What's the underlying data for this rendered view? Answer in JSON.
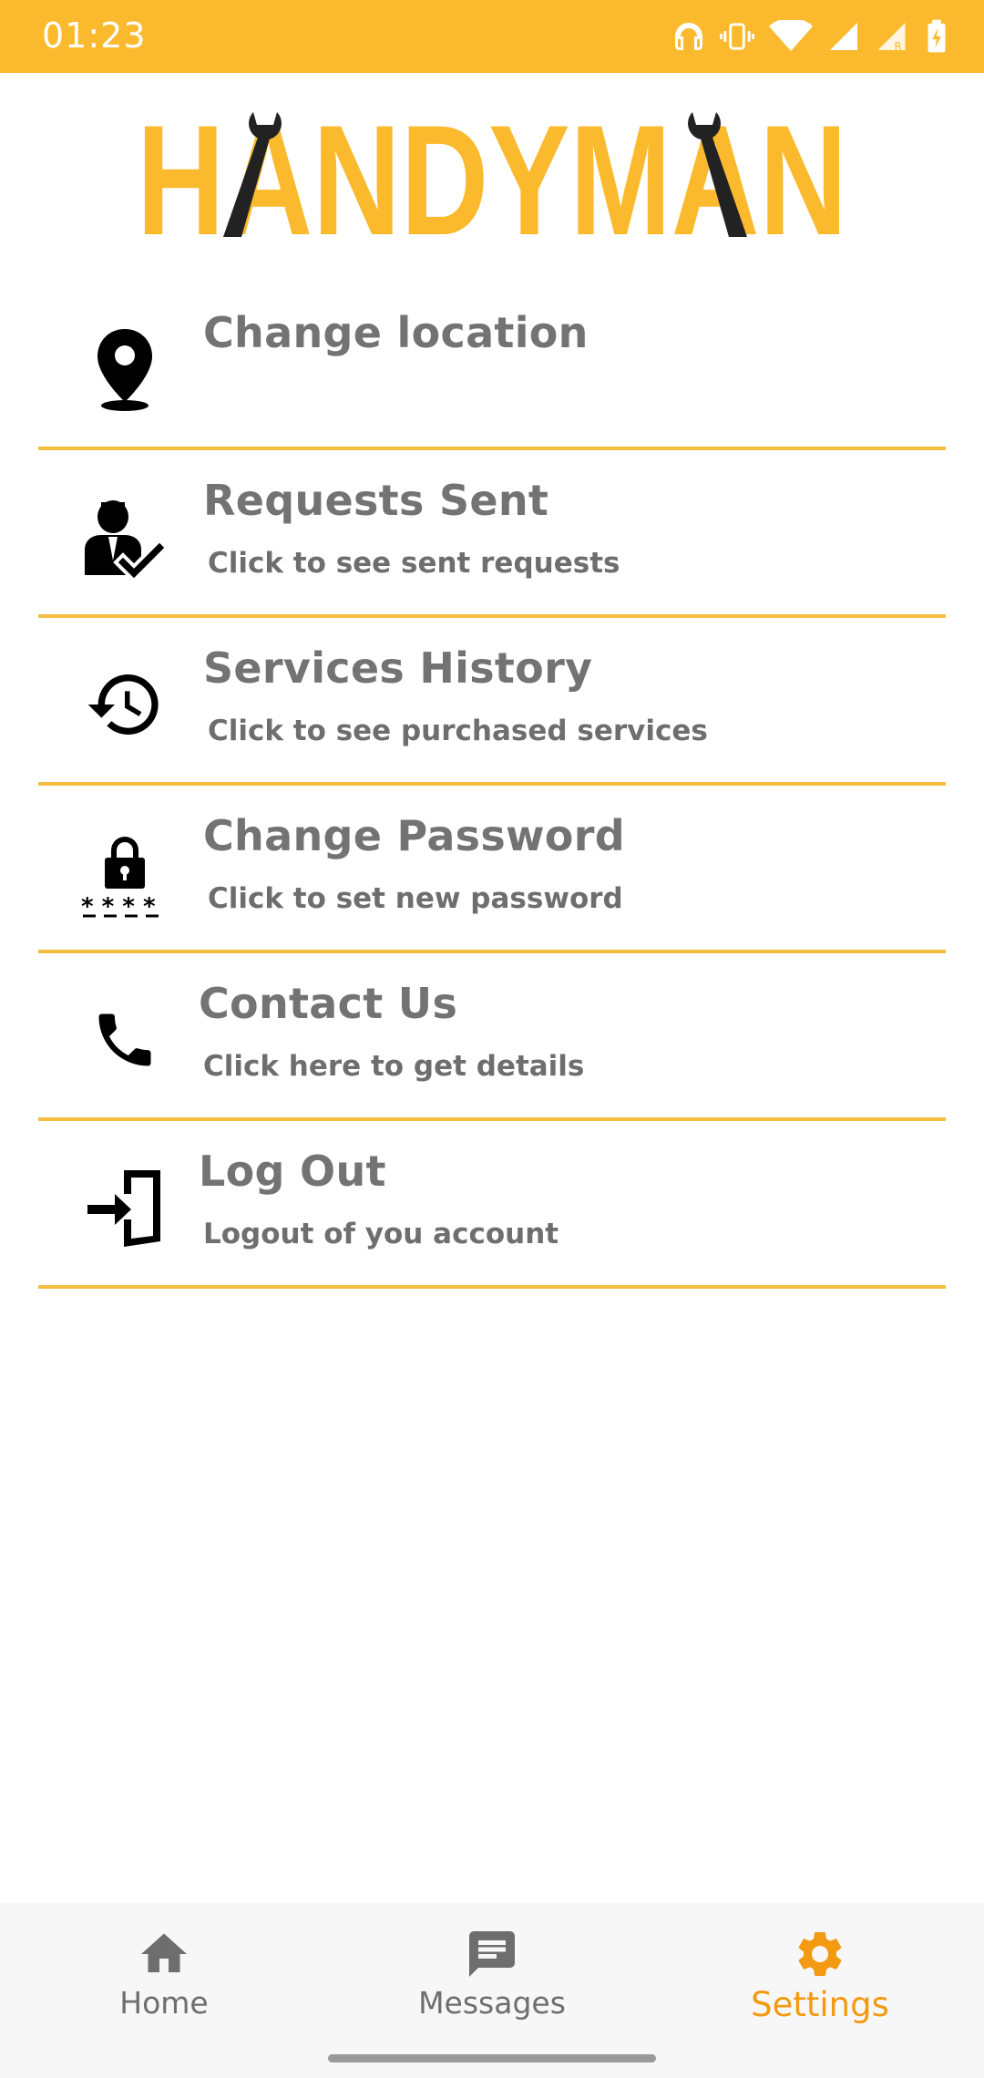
{
  "status_bar": {
    "time": "01:23",
    "icons": [
      "headphones-icon",
      "vibrate-icon",
      "wifi-icon",
      "signal-icon",
      "signal-roaming-icon",
      "battery-charging-icon"
    ]
  },
  "logo": {
    "text": "HANDYMAN",
    "color": "#FBBA2E",
    "accent_color": "#222222"
  },
  "menu": {
    "items": [
      {
        "title": "Change location",
        "subtitle": "",
        "icon": "location-pin-icon"
      },
      {
        "title": "Requests Sent",
        "subtitle": "Click to see sent requests",
        "icon": "user-check-icon"
      },
      {
        "title": "Services History",
        "subtitle": "Click to see purchased services",
        "icon": "history-icon"
      },
      {
        "title": "Change Password",
        "subtitle": "Click to set new password",
        "icon": "password-lock-icon"
      },
      {
        "title": "Contact Us",
        "subtitle": "Click here to get details",
        "icon": "phone-icon"
      },
      {
        "title": "Log Out",
        "subtitle": "Logout of you account",
        "icon": "logout-door-icon"
      }
    ]
  },
  "bottom_nav": {
    "items": [
      {
        "label": "Home",
        "icon": "home-icon",
        "active": false
      },
      {
        "label": "Messages",
        "icon": "messages-icon",
        "active": false
      },
      {
        "label": "Settings",
        "icon": "gear-icon",
        "active": true
      }
    ]
  },
  "colors": {
    "accent": "#FBBA2E",
    "divider": "#F3BE3E",
    "active_tab": "#F39A12",
    "text_gray": "#737373"
  }
}
